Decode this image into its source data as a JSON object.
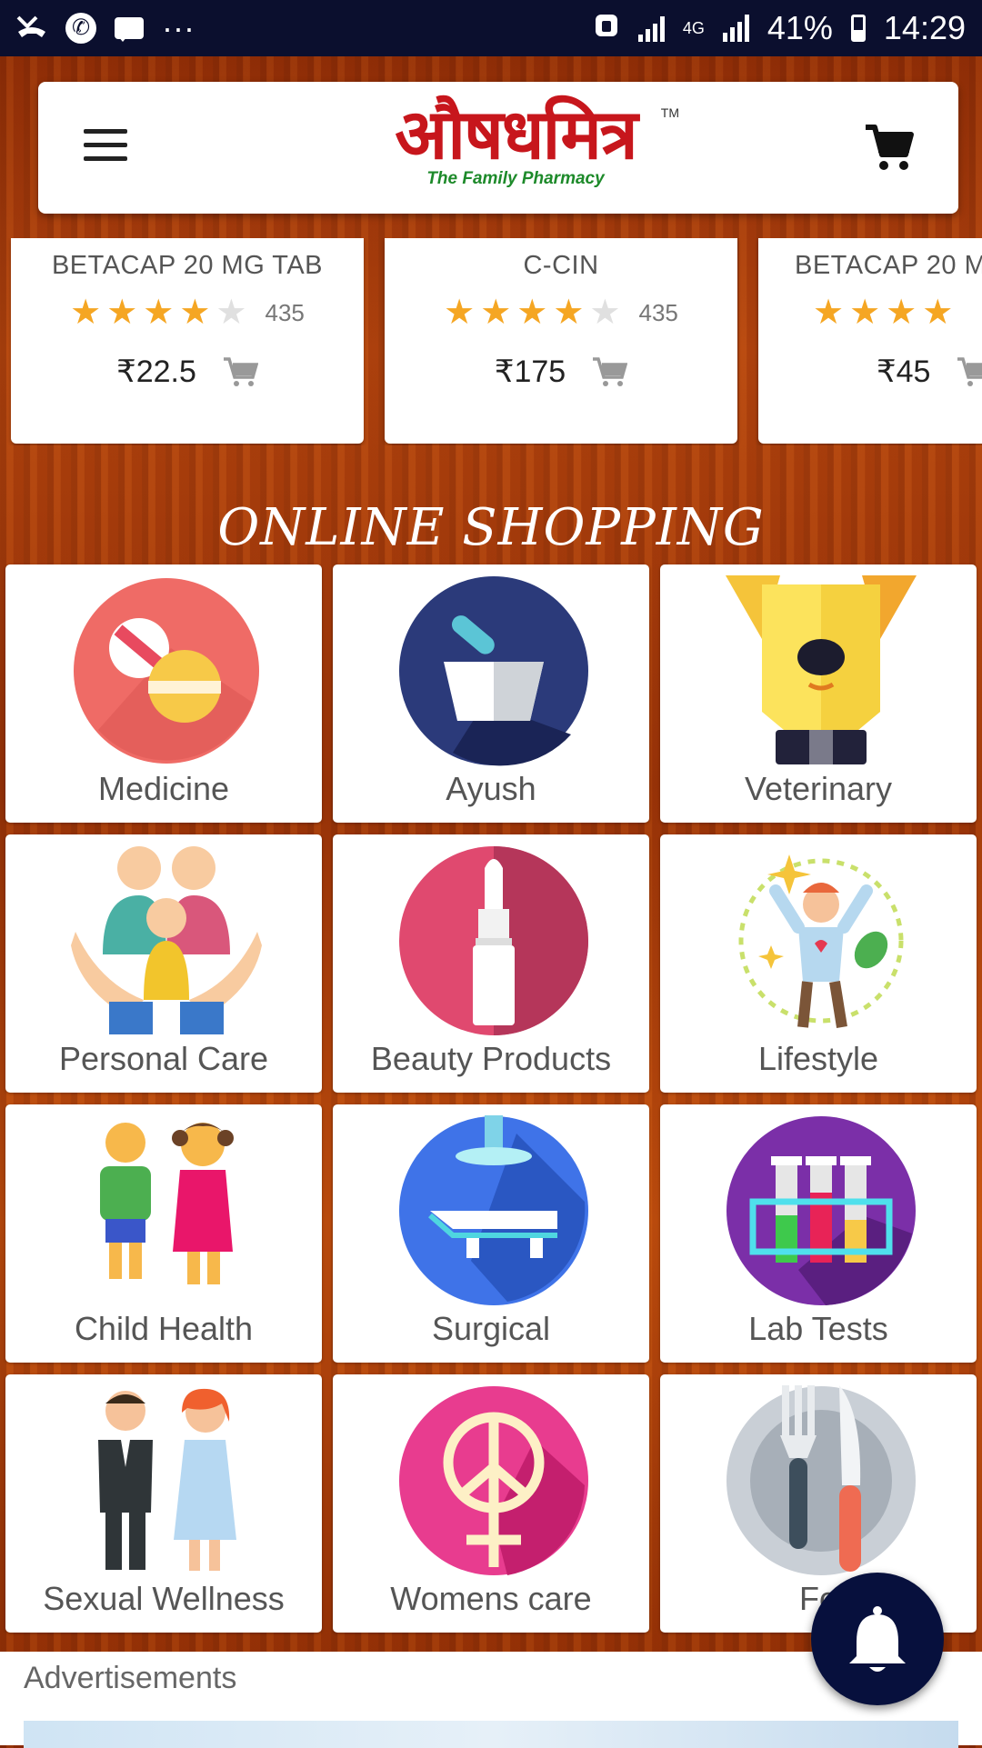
{
  "status_bar": {
    "more": "···",
    "network": "4G",
    "battery": "41%",
    "time": "14:29"
  },
  "header": {
    "logo_title": "औषधमित्र",
    "logo_tm": "TM",
    "logo_subtitle": "The Family Pharmacy"
  },
  "products": [
    {
      "name": "BETACAP 20 MG TAB",
      "rating": 4,
      "reviews": "435",
      "currency": "₹",
      "price": "22.5"
    },
    {
      "name": "C-CIN",
      "rating": 4,
      "reviews": "435",
      "currency": "₹",
      "price": "175"
    },
    {
      "name": "BETACAP 20 M",
      "rating": 4,
      "reviews": "",
      "currency": "₹",
      "price": "45"
    }
  ],
  "section": {
    "title": "ONLINE SHOPPING"
  },
  "categories": [
    {
      "label": "Medicine",
      "icon": "medicine-icon"
    },
    {
      "label": "Ayush",
      "icon": "mortar-pestle-icon"
    },
    {
      "label": "Veterinary",
      "icon": "dog-icon"
    },
    {
      "label": "Personal Care",
      "icon": "family-hands-icon"
    },
    {
      "label": "Beauty Products",
      "icon": "lipstick-icon"
    },
    {
      "label": "Lifestyle",
      "icon": "happy-person-icon"
    },
    {
      "label": "Child Health",
      "icon": "children-icon"
    },
    {
      "label": "Surgical",
      "icon": "surgical-bed-icon"
    },
    {
      "label": "Lab Tests",
      "icon": "test-tubes-icon"
    },
    {
      "label": "Sexual Wellness",
      "icon": "couple-icon"
    },
    {
      "label": "Womens care",
      "icon": "female-peace-icon"
    },
    {
      "label": "Fo",
      "icon": "fork-knife-plate-icon"
    }
  ],
  "ads": {
    "label": "Advertisements"
  },
  "colors": {
    "status_bar": "#0b0f2e",
    "fab": "#07103d",
    "logo_red": "#c7161c",
    "logo_green": "#1d8a2a",
    "star": "#f5a623"
  }
}
